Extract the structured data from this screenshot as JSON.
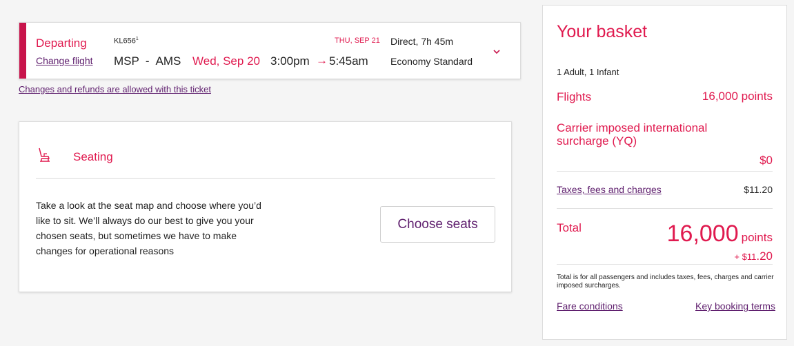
{
  "flight": {
    "status_label": "Departing",
    "change_label": "Change flight",
    "flight_code": "KL656",
    "flight_code_note": "1",
    "origin": "MSP",
    "separator": "-",
    "destination": "AMS",
    "departure_date": "Wed, Sep 20",
    "departure_time": "3:00pm",
    "arrow": "→",
    "arrival_time": "5:45am",
    "arrival_date": "THU, SEP 21",
    "duration": "Direct, 7h 45m",
    "cabin": "Economy Standard"
  },
  "refund_link": "Changes and refunds are allowed with this ticket",
  "seating": {
    "title": "Seating",
    "description": "Take a look at the seat map and choose where you’d like to sit. We’ll always do our best to give you your chosen seats, but sometimes we have to make changes for operational reasons",
    "button_label": "Choose seats"
  },
  "basket": {
    "title": "Your basket",
    "passengers": "1 Adult, 1 Infant",
    "flights_label": "Flights",
    "flights_value": "16,000 points",
    "surcharge_label": "Carrier imposed international surcharge (YQ)",
    "surcharge_value": "$0",
    "taxes_label": "Taxes, fees and charges",
    "taxes_value": "$11.20",
    "total_label": "Total",
    "total_points": "16,000",
    "total_points_unit": "points",
    "total_cash_prefix": "+ $11",
    "total_cash_suffix": ".20",
    "total_note": "Total is for all passengers and includes taxes, fees, charges and carrier imposed surcharges.",
    "fare_conditions": "Fare conditions",
    "key_booking_terms": "Key booking terms"
  },
  "colors": {
    "accent": "#e01a4f",
    "accent_bar": "#c8144b",
    "link": "#5f1f6e",
    "background": "#f5f5f5"
  },
  "icons": {
    "seat": "seat-icon",
    "expand": "chevron-down-icon"
  }
}
